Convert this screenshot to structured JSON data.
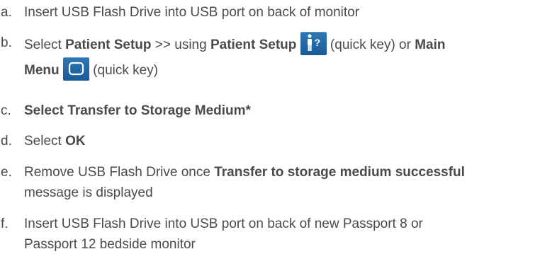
{
  "colors": {
    "text": "#4a4a4a",
    "key_blue_top": "#2e78b8",
    "key_blue_bottom": "#1a5a96"
  },
  "steps": [
    {
      "letter": "a.",
      "text": "Insert USB Flash Drive into USB port on back of monitor"
    },
    {
      "letter": "b.",
      "pre": "Select ",
      "patient_setup": "Patient Setup",
      "arrows": " >> using ",
      "patient_setup_2": "Patient Setup",
      "quick_key_1": " (quick key) or ",
      "main": "Main",
      "menu": "Menu",
      "quick_key_2": " (quick key)",
      "icon_patient": "patient-setup-icon",
      "icon_menu": "main-menu-icon"
    },
    {
      "letter": "c.",
      "text": "Select Transfer to Storage Medium*"
    },
    {
      "letter": "d.",
      "pre": "Select ",
      "bold": "OK"
    },
    {
      "letter": "e.",
      "pre": "Remove USB Flash Drive once ",
      "bold": "Transfer to storage medium successful",
      "post": "message is displayed"
    },
    {
      "letter": "f.",
      "line1": "Insert USB Flash Drive into USB port on back of new Passport 8 or",
      "line2": "Passport 12 bedside monitor"
    }
  ]
}
